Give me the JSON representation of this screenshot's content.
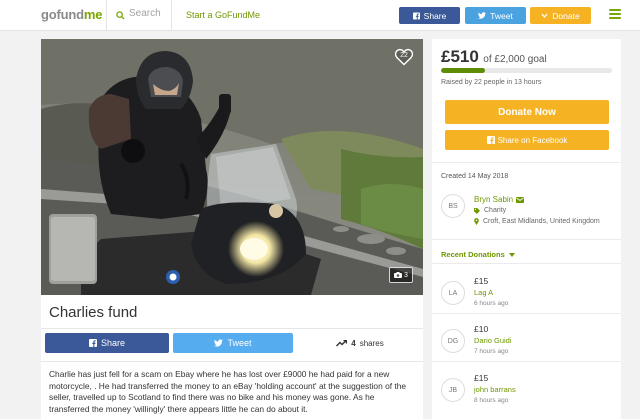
{
  "header": {
    "logo_prefix": "go",
    "logo_mid": "fund",
    "logo_suffix": "me",
    "search_placeholder": "Search",
    "start_link": "Start a GoFundMe",
    "share_label": "Share",
    "tweet_label": "Tweet",
    "donate_label": "Donate"
  },
  "colors": {
    "brand_green": "#7aa600",
    "facebook_blue": "#3b5998",
    "twitter_blue": "#55acee",
    "donate_orange": "#f5b324"
  },
  "photo": {
    "hearts": "22",
    "photo_count": "3"
  },
  "campaign": {
    "title": "Charlies fund",
    "share_label": "Share",
    "tweet_label": "Tweet",
    "shares_count": "4",
    "shares_label": "shares",
    "story": "Charlie has just fell for a scam on Ebay where he has lost over £9000 he had paid for a new motorcycle, . He had transferred the money to an eBay 'holding account' at the suggestion of the seller, travelled up to Scotland to find there was no bike and his money was gone.  As he transferred the money 'willingly' there appears little he can do about it."
  },
  "sidebar": {
    "raised": "£510",
    "goal": "of £2,000 goal",
    "progress_fraction": 0.255,
    "raised_by": "Raised by 22 people in 13 hours",
    "donate_now": "Donate Now",
    "share_facebook": "Share on Facebook",
    "created": "Created 14 May 2018",
    "organizer": {
      "initials": "BS",
      "name": "Bryn Sabin",
      "type": "Charity",
      "location": "Croft, East Midlands, United Kingdom"
    },
    "recent_label": "Recent Donations",
    "donations": [
      {
        "initials": "LA",
        "amount": "£15",
        "name": "Lag A",
        "time": "6 hours ago"
      },
      {
        "initials": "DG",
        "amount": "£10",
        "name": "Dario Guidi",
        "time": "7 hours ago"
      },
      {
        "initials": "JB",
        "amount": "£15",
        "name": "john barrans",
        "time": "8 hours ago"
      }
    ]
  }
}
